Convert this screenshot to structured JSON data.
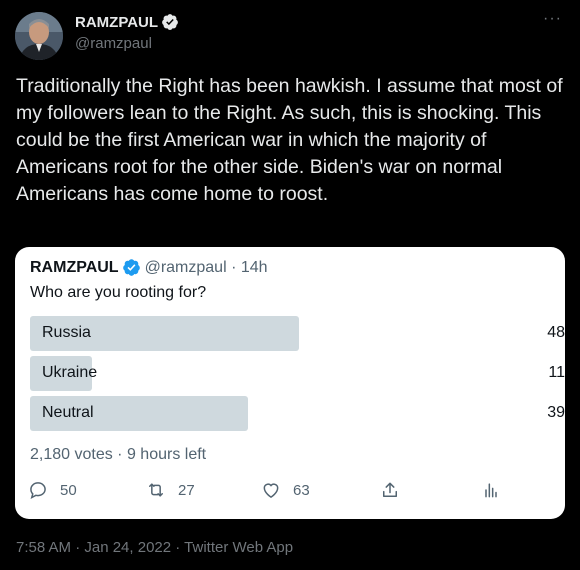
{
  "author": {
    "display_name": "RAMZPAUL",
    "handle": "@ramzpaul",
    "verified": true
  },
  "more_menu": "···",
  "tweet_text": "Traditionally the Right has been hawkish. I assume that most of my followers lean to the Right. As such, this is shocking. This could be the first American war in which the majority of Americans root for the other side. Biden's war on normal Americans has come home to roost.",
  "quoted_tweet": {
    "display_name": "RAMZPAUL",
    "handle_time": "@ramzpaul · 14h",
    "question": "Who are you rooting for?",
    "poll": [
      {
        "label": "Russia",
        "percent_text": "48",
        "fraction": 0.48
      },
      {
        "label": "Ukraine",
        "percent_text": "11",
        "fraction": 0.11
      },
      {
        "label": "Neutral",
        "percent_text": "39",
        "fraction": 0.39
      }
    ],
    "meta": "2,180 votes · 9 hours left",
    "actions": {
      "reply_count": "50",
      "retweet_count": "27",
      "like_count": "63"
    }
  },
  "timestamp": "7:58 AM · Jan 24, 2022 · Twitter Web App",
  "colors": {
    "background": "#000000",
    "card": "#ffffff",
    "poll_bar": "#cfd9de",
    "verified": "#1d9bf0"
  }
}
